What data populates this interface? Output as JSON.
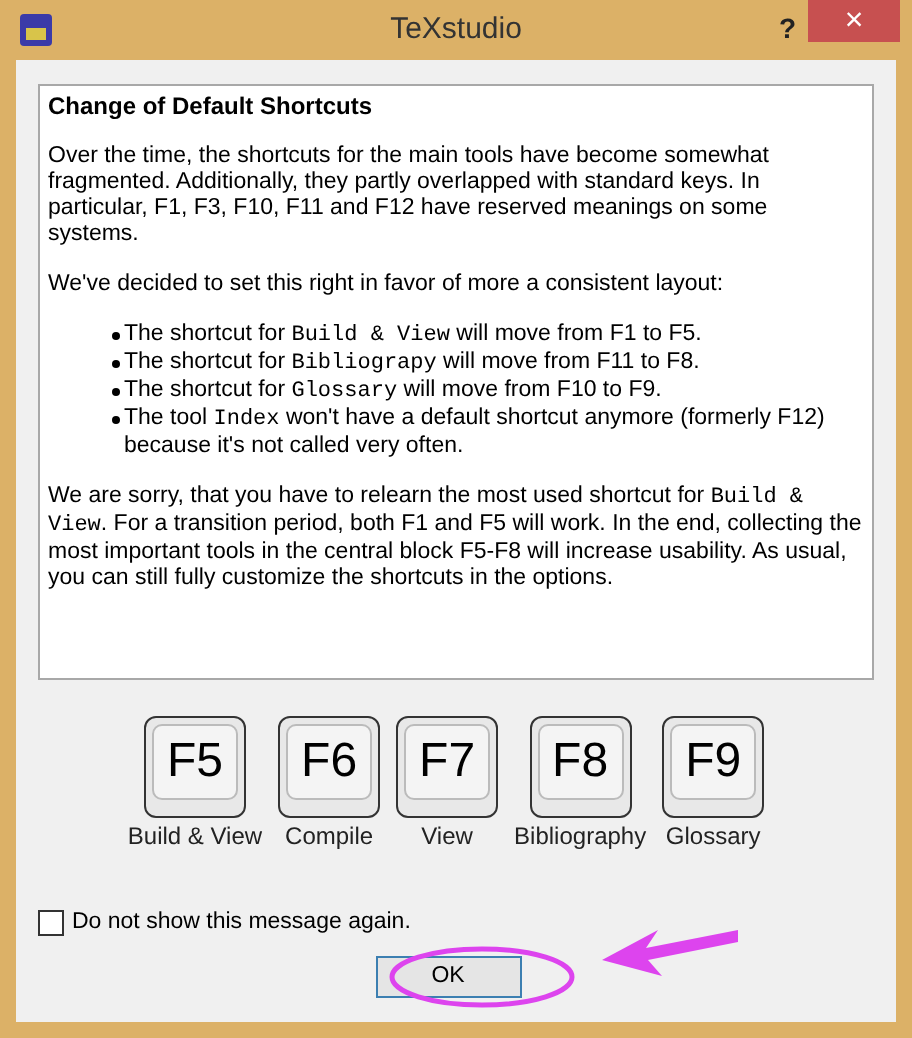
{
  "window": {
    "title": "TeXstudio",
    "help_button": "?",
    "close_button": "×"
  },
  "message": {
    "heading": "Change of Default Shortcuts",
    "paragraphs": [
      [
        {
          "kind": "text",
          "text": "Over the time, the shortcuts for the main tools have become somewhat fragmented. Additionally, they partly overlapped with standard keys. In particular, F1, F3, F10, F11 and F12 have reserved meanings on some systems."
        }
      ],
      [
        {
          "kind": "text",
          "text": "We've decided to set this right in favor of more a consistent layout:"
        }
      ]
    ],
    "bullets": [
      [
        {
          "kind": "text",
          "text": "The shortcut for "
        },
        {
          "kind": "code",
          "text": "Build & View"
        },
        {
          "kind": "text",
          "text": " will move from F1 to F5."
        }
      ],
      [
        {
          "kind": "text",
          "text": "The shortcut for "
        },
        {
          "kind": "code",
          "text": "Bibliograpy"
        },
        {
          "kind": "text",
          "text": " will move from F11 to F8."
        }
      ],
      [
        {
          "kind": "text",
          "text": "The shortcut for "
        },
        {
          "kind": "code",
          "text": "Glossary"
        },
        {
          "kind": "text",
          "text": " will move from F10 to F9."
        }
      ],
      [
        {
          "kind": "text",
          "text": "The tool "
        },
        {
          "kind": "code",
          "text": "Index"
        },
        {
          "kind": "text",
          "text": " won't have a default shortcut anymore (formerly F12) because it's not called very often."
        }
      ]
    ],
    "closing": [
      {
        "kind": "text",
        "text": "We are sorry, that you have to relearn the most used shortcut for "
      },
      {
        "kind": "code",
        "text": "Build & View"
      },
      {
        "kind": "text",
        "text": ". For a transition period, both F1 and F5 will work. In the end, collecting the most important tools in the central block F5-F8 will increase usability. As usual, you can still fully customize the shortcuts in the options."
      }
    ]
  },
  "keys": [
    {
      "key": "F5",
      "label": "Build & View"
    },
    {
      "key": "F6",
      "label": "Compile"
    },
    {
      "key": "F7",
      "label": "View"
    },
    {
      "key": "F8",
      "label": "Bibliography"
    },
    {
      "key": "F9",
      "label": "Glossary"
    }
  ],
  "checkbox": {
    "label": "Do not show this message again.",
    "checked": false
  },
  "ok_button": "OK"
}
